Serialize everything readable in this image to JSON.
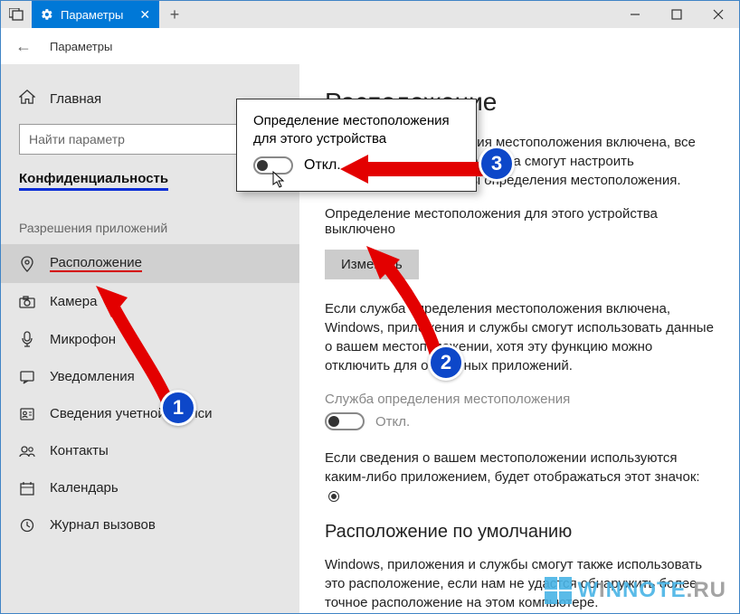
{
  "titlebar": {
    "tab_label": "Параметры",
    "breadcrumb": "Параметры"
  },
  "sidebar": {
    "home": "Главная",
    "search_placeholder": "Найти параметр",
    "privacy_heading": "Конфиденциальность",
    "app_permissions": "Разрешения приложений",
    "items": [
      {
        "label": "Расположение"
      },
      {
        "label": "Камера"
      },
      {
        "label": "Микрофон"
      },
      {
        "label": "Уведомления"
      },
      {
        "label": "Сведения учетной записи"
      },
      {
        "label": "Контакты"
      },
      {
        "label": "Календарь"
      },
      {
        "label": "Журнал вызовов"
      }
    ]
  },
  "content": {
    "title": "Расположение",
    "p1": "Если служба определения местоположения включена, все пользователи этого устройства смогут настроить собственные параметры определения местоположения.",
    "status": "Определение местоположения для этого устройства выключено",
    "change_btn": "Изменить",
    "p2": "Если служба определения местоположения включена, Windows, приложения и службы смогут использовать данные о вашем местоположении, хотя эту функцию можно отключить для отдельных приложений.",
    "service_label": "Служба определения местоположения",
    "service_state": "Откл.",
    "p3_a": "Если сведения о вашем местоположении используются каким-либо приложением, будет отображаться этот значок: ",
    "h2": "Расположение по умолчанию",
    "p4": "Windows, приложения и службы смогут также использовать это расположение, если нам не удастся обнаружить более точное расположение на этом компьютере."
  },
  "popup": {
    "text": "Определение местоположения для этого устройства",
    "state": "Откл."
  },
  "annotations": {
    "b1": "1",
    "b2": "2",
    "b3": "3"
  },
  "watermark": {
    "pre": "W",
    "mid": "I",
    "post": "NNOTE",
    "suffix": ".RU"
  }
}
